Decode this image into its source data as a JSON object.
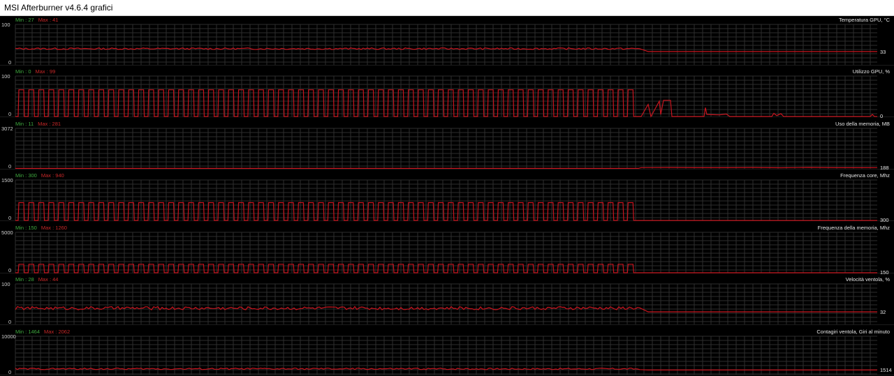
{
  "window": {
    "title": "MSI Afterburner v4.6.4 grafici"
  },
  "colors": {
    "line": "#c8141e",
    "grid": "#2e2e2e",
    "min": "#3fa83f",
    "max": "#c82828",
    "background": "#000000"
  },
  "graphs": [
    {
      "title": "Temperatura GPU, °C",
      "axis_max": "100",
      "axis_min": "0",
      "min_label": "Min : 27",
      "max_label": "Max : 41",
      "current": "33",
      "trace": {
        "pattern": "noise",
        "active_level": 0.4,
        "active_amp": 0.02,
        "idle_level": 0.33
      }
    },
    {
      "title": "Utilizzo GPU, %",
      "axis_max": "100",
      "axis_min": "0",
      "min_label": "Min : 0",
      "max_label": "Max : 99",
      "current": "0",
      "trace": {
        "pattern": "pulse",
        "high": 0.66,
        "low": 0.0,
        "idle_level": 0.0,
        "extras": "spikes"
      }
    },
    {
      "title": "Uso della memoria, MB",
      "axis_max": "3072",
      "axis_min": "0",
      "min_label": "Min : 11",
      "max_label": "Max : 281",
      "current": "188",
      "trace": {
        "pattern": "flat",
        "active_level": 0.01,
        "idle_level": 0.03
      }
    },
    {
      "title": "Frequenza core, Mhz",
      "axis_max": "1500",
      "axis_min": "0",
      "min_label": "Min : 300",
      "max_label": "Max : 940",
      "current": "300",
      "trace": {
        "pattern": "pulse",
        "high": 0.44,
        "low": 0.0,
        "idle_level": 0.0
      }
    },
    {
      "title": "Frequenza della memoria, Mhz",
      "axis_max": "5000",
      "axis_min": "0",
      "min_label": "Min : 150",
      "max_label": "Max : 1260",
      "current": "150",
      "trace": {
        "pattern": "pulse",
        "high": 0.21,
        "low": 0.0,
        "idle_level": 0.0
      }
    },
    {
      "title": "Velocità ventola, %",
      "axis_max": "100",
      "axis_min": "0",
      "min_label": "Min : 28",
      "max_label": "Max : 44",
      "current": "32",
      "trace": {
        "pattern": "noise",
        "active_level": 0.4,
        "active_amp": 0.04,
        "idle_level": 0.31
      }
    },
    {
      "title": "Contagiri ventola, Giri al minuto",
      "axis_max": "10000",
      "axis_min": "0",
      "min_label": "Min : 1464",
      "max_label": "Max : 2062",
      "current": "1514",
      "trace": {
        "pattern": "noise",
        "active_level": 0.15,
        "active_amp": 0.02,
        "idle_level": 0.12
      }
    }
  ]
}
